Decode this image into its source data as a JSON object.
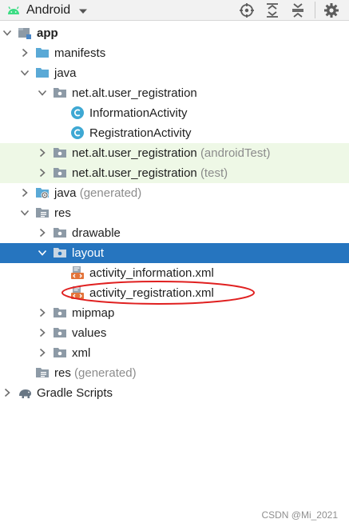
{
  "toolbar": {
    "view_label": "Android",
    "view_icon": "android-icon",
    "buttons": [
      {
        "icon": "locate-crosshair-icon"
      },
      {
        "icon": "expand-all-icon"
      },
      {
        "icon": "collapse-all-icon"
      },
      {
        "icon": "gear-icon"
      }
    ]
  },
  "colors": {
    "selection": "#2675bf",
    "test_background": "#eef8e6",
    "folder": "#5aa9d6",
    "package": "#8d9aa6",
    "class_badge": "#3ea8d3",
    "xml_badge": "#e3743a",
    "android": "#3ddc84",
    "annotation": "#e02020"
  },
  "tree": [
    {
      "label": "app",
      "suffix": "",
      "icon": "module-icon",
      "arrow": "expanded"
    },
    {
      "label": "manifests",
      "suffix": "",
      "icon": "folder-icon",
      "arrow": "collapsed"
    },
    {
      "label": "java",
      "suffix": "",
      "icon": "folder-icon",
      "arrow": "expanded"
    },
    {
      "label": "net.alt.user_registration",
      "suffix": "",
      "icon": "package-icon",
      "arrow": "expanded"
    },
    {
      "label": "InformationActivity",
      "suffix": "",
      "icon": "class-icon",
      "arrow": "none"
    },
    {
      "label": "RegistrationActivity",
      "suffix": "",
      "icon": "class-icon",
      "arrow": "none"
    },
    {
      "label": "net.alt.user_registration",
      "suffix": "(androidTest)",
      "icon": "package-icon",
      "arrow": "collapsed"
    },
    {
      "label": "net.alt.user_registration",
      "suffix": "(test)",
      "icon": "package-icon",
      "arrow": "collapsed"
    },
    {
      "label": "java",
      "suffix": "(generated)",
      "icon": "generated-folder-icon",
      "arrow": "collapsed"
    },
    {
      "label": "res",
      "suffix": "",
      "icon": "resource-folder-icon",
      "arrow": "expanded"
    },
    {
      "label": "drawable",
      "suffix": "",
      "icon": "package-icon",
      "arrow": "collapsed"
    },
    {
      "label": "layout",
      "suffix": "",
      "icon": "package-icon",
      "arrow": "expanded",
      "selected": true
    },
    {
      "label": "activity_information.xml",
      "suffix": "",
      "icon": "xml-layout-icon",
      "arrow": "none"
    },
    {
      "label": "activity_registration.xml",
      "suffix": "",
      "icon": "xml-layout-icon",
      "arrow": "none",
      "circled": true
    },
    {
      "label": "mipmap",
      "suffix": "",
      "icon": "package-icon",
      "arrow": "collapsed"
    },
    {
      "label": "values",
      "suffix": "",
      "icon": "package-icon",
      "arrow": "collapsed"
    },
    {
      "label": "xml",
      "suffix": "",
      "icon": "package-icon",
      "arrow": "collapsed"
    },
    {
      "label": "res",
      "suffix": "(generated)",
      "icon": "resource-folder-icon",
      "arrow": "none"
    },
    {
      "label": "Gradle Scripts",
      "suffix": "",
      "icon": "gradle-elephant-icon",
      "arrow": "collapsed"
    }
  ],
  "watermark": "CSDN @Mi_2021"
}
